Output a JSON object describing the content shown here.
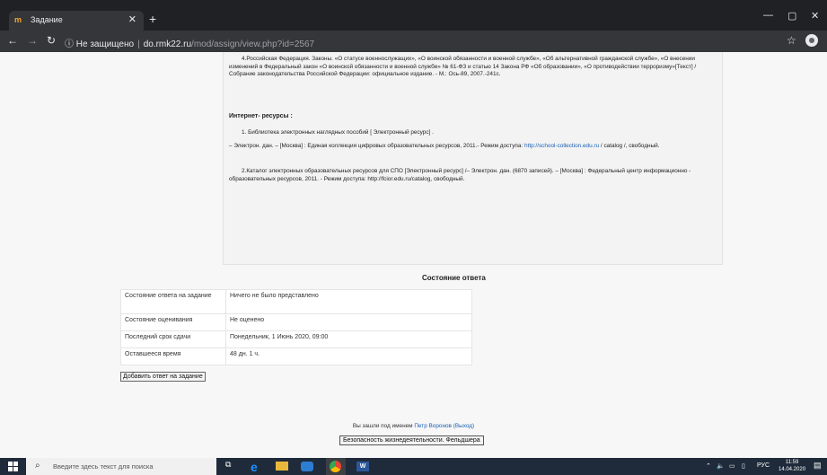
{
  "browser": {
    "tab_title": "Задание",
    "tab_favicon": "m",
    "security_label": "Не защищено",
    "url_host": "do.rmk22.ru",
    "url_path": "/mod/assign/view.php?id=2567"
  },
  "assignment_text": {
    "paragraph1": "4.Российская Федерация. Законы. «О статусе военнослужащих», «О воинской обязанности и военной службе», «Об альтернативной гражданской службе», «О внесении изменений в Федеральный закон «О воинской обязанности и военной службе» № 61-ФЗ и статью 14 Закона РФ «Об образовании», «О противодействии терроризму»[Текст] / Собрание законодательства Российской Федерации: официальное издание. - М.: Ось-89, 2007.-241с.",
    "internet_heading": "Интернет- ресурсы :",
    "item1": "1. Библиотека электронных наглядных пособий [ Электронный ресурс] .",
    "item1_details_pre": "– Электрон. дан. – [Москва] : Единая коллекция цифровых образовательных ресурсов, 2011.- Режим доступа:",
    "item1_link": "http://school-collection.edu.ru",
    "item1_details_post": "/ catalog /, свободный.",
    "item2": "2.Каталог электронных образовательных ресурсов для СПО [Электронный ресурс] /– Электрон. дан. (6870 записей). – [Москва] : Федеральный центр информационно - образовательных ресурсов, 2011. - Режим доступа: http://fcior.edu.ru/catalog, свободный."
  },
  "submission": {
    "title": "Состояние ответа",
    "rows": [
      {
        "label": "Состояние ответа на задание",
        "value": "Ничего не было представлено"
      },
      {
        "label": "Состояние оценивания",
        "value": "Не оценено"
      },
      {
        "label": "Последний срок сдачи",
        "value": "Понедельник, 1 Июнь 2020, 09:00"
      },
      {
        "label": "Оставшееся время",
        "value": "48 дн. 1 ч."
      }
    ],
    "add_button": "Добавить ответ на задание"
  },
  "footer": {
    "login_prefix": "Вы зашли под именем",
    "user_name": "Петр Воронов",
    "logout": "(Выход)",
    "course_button": "Безопасность жизнедеятельности. Фельдшера"
  },
  "taskbar": {
    "search_placeholder": "Введите здесь текст для поиска",
    "language": "РУС",
    "time": "11:59",
    "date": "14.04.2020"
  },
  "colors": {
    "link": "#1a5fb4",
    "chrome_dark": "#202124",
    "taskbar": "#1f2b3a"
  }
}
